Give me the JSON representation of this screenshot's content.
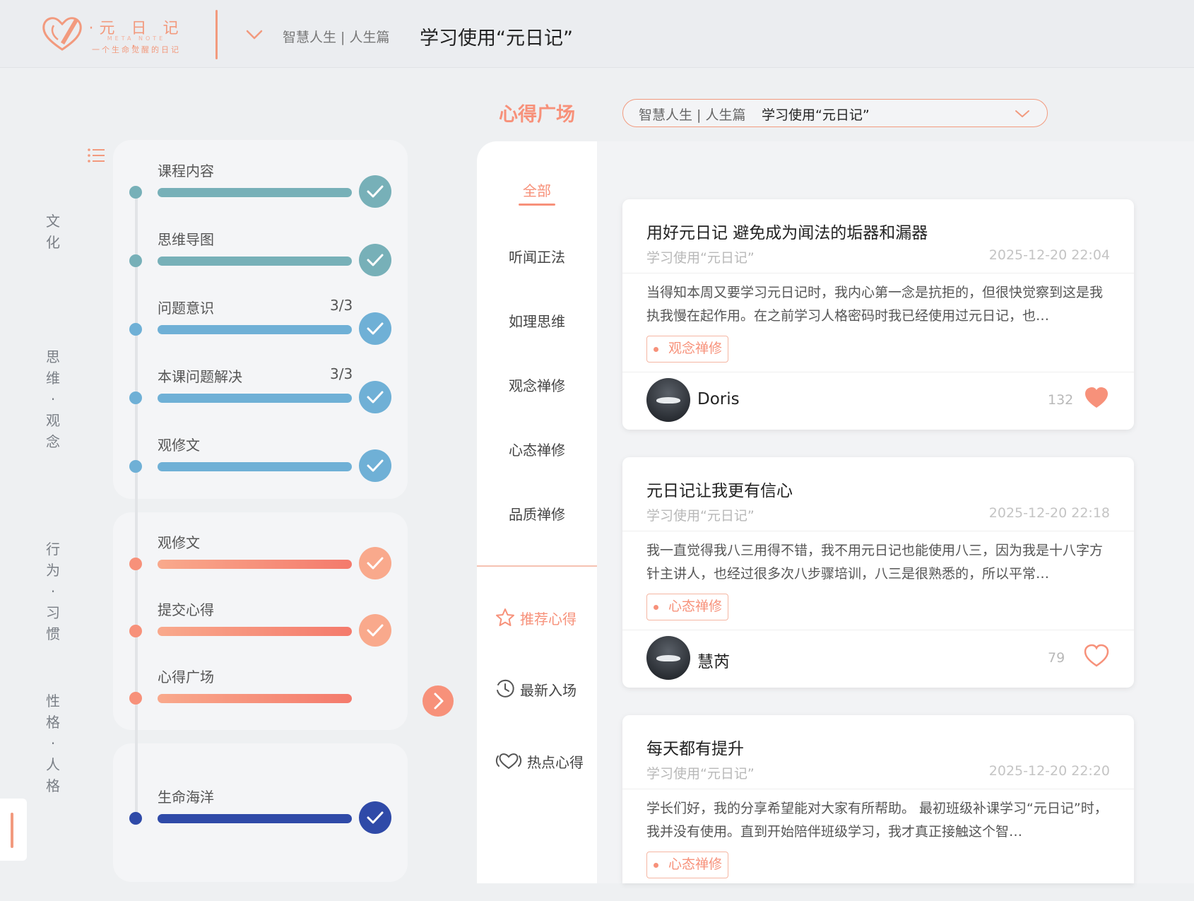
{
  "header": {
    "logo_title": "·元 日 记·",
    "logo_en": "META NOTE",
    "logo_subtitle": "一个生命觉醒的日记",
    "crumb": "智慧人生 | 人生篇",
    "title": "学习使用“元日记”"
  },
  "side_labels": [
    {
      "text": "文\n化"
    },
    {
      "text": "思\n维\n·\n观\n念"
    },
    {
      "text": "行\n为\n·\n习\n惯"
    },
    {
      "text": "性\n格\n·\n人\n格"
    }
  ],
  "course_steps": [
    {
      "label": "课程内容",
      "count": "",
      "color": "#77b0b8",
      "done": true
    },
    {
      "label": "思维导图",
      "count": "",
      "color": "#77b0b8",
      "done": true
    },
    {
      "label": "问题意识",
      "count": "3/3",
      "color": "#6fb0d6",
      "done": true
    },
    {
      "label": "本课问题解决",
      "count": "3/3",
      "color": "#6fb0d6",
      "done": true
    },
    {
      "label": "观修文",
      "count": "",
      "color": "#6fb0d6",
      "done": true
    },
    {
      "label": "观修文",
      "count": "",
      "color": "#f7917a",
      "done": true
    },
    {
      "label": "提交心得",
      "count": "",
      "color": "#f7917a",
      "done": true
    },
    {
      "label": "心得广场",
      "count": "",
      "color": "#f7917a",
      "done": false
    },
    {
      "label": "生命海洋",
      "count": "",
      "color": "#2f4aa8",
      "done": true
    }
  ],
  "plaza": {
    "title": "心得广场",
    "filter_crumb": "智慧人生 | 人生篇",
    "filter_course": "学习使用“元日记”"
  },
  "categories": {
    "all": "全部",
    "items": [
      "听闻正法",
      "如理思维",
      "观念禅修",
      "心态禅修",
      "品质禅修"
    ],
    "recommended": "推荐心得",
    "latest": "最新入场",
    "hot": "热点心得"
  },
  "posts": [
    {
      "title": "用好元日记 避免成为闻法的垢器和漏器",
      "course": "学习使用“元日记”",
      "time": "2025-12-20 22:04",
      "excerpt": "当得知本周又要学习元日记时，我内心第一念是抗拒的，但很快觉察到这是我执我慢在起作用。在之前学习人格密码时我已经使用过元日记，也…",
      "tag": "观念禅修",
      "author": "Doris",
      "likes": "132",
      "liked": true
    },
    {
      "title": "元日记让我更有信心",
      "course": "学习使用“元日记”",
      "time": "2025-12-20 22:18",
      "excerpt": "我一直觉得我八三用得不错，我不用元日记也能使用八三，因为我是十八字方针主讲人，也经过很多次八步骤培训，八三是很熟悉的，所以平常…",
      "tag": "心态禅修",
      "author": "慧芮",
      "likes": "79",
      "liked": false
    },
    {
      "title": "每天都有提升",
      "course": "学习使用“元日记”",
      "time": "2025-12-20 22:20",
      "excerpt": "学长们好，我的分享希望能对大家有所帮助。 最初班级补课学习“元日记”时，我并没有使用。直到开始陪伴班级学习，我才真正接触这个智…",
      "tag": "心态禅修"
    }
  ],
  "colors": {
    "accent": "#f7917a",
    "teal": "#77b0b8",
    "blue": "#6fb0d6",
    "navy": "#2f4aa8"
  }
}
